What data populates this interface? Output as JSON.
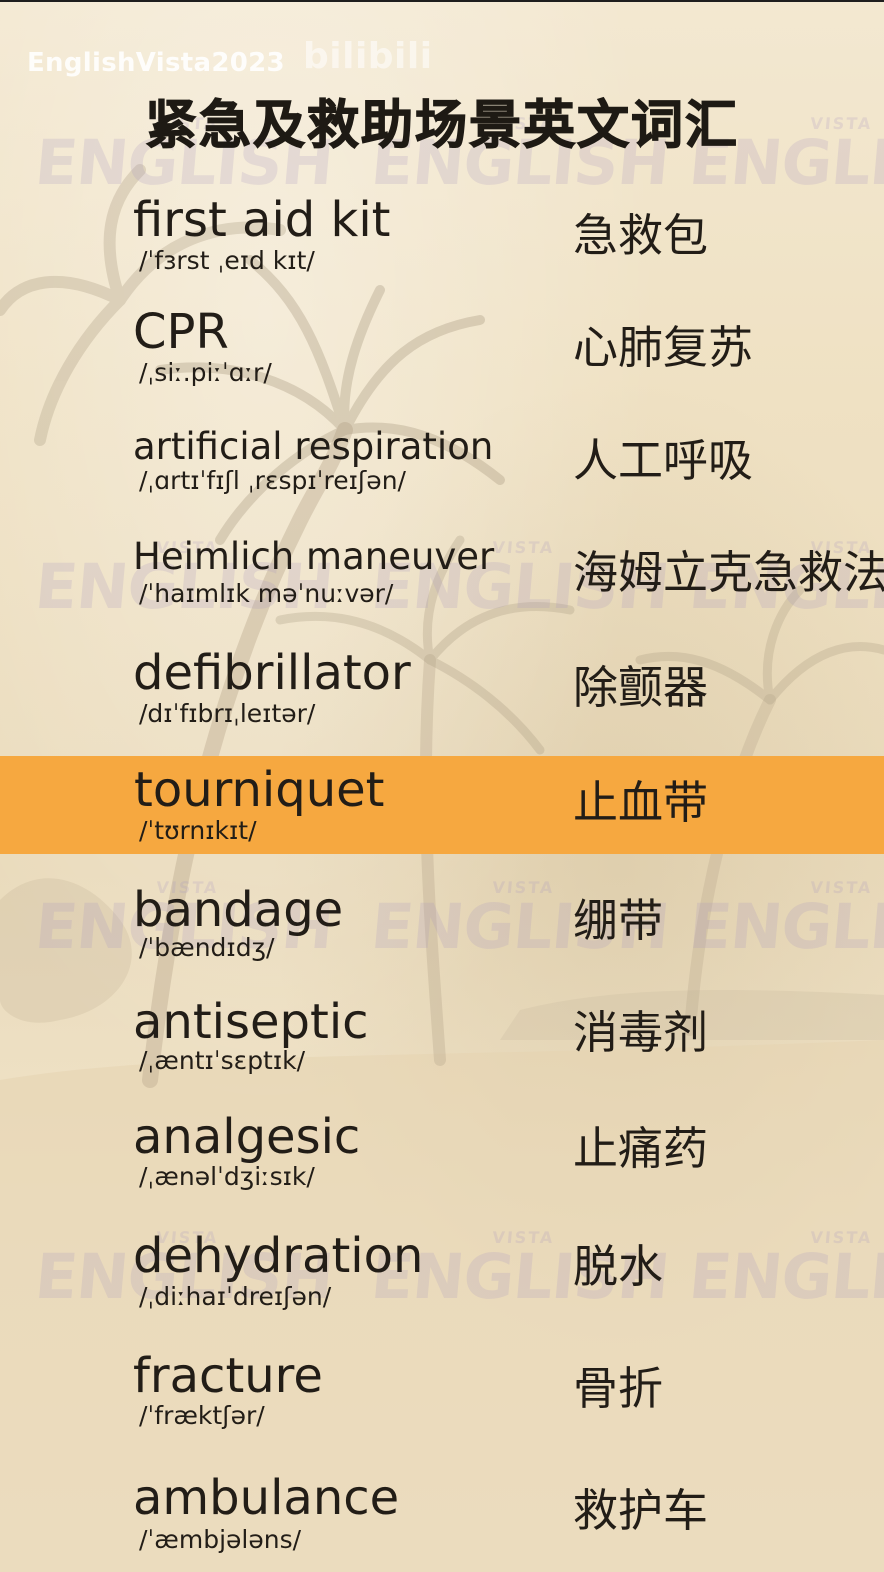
{
  "header": {
    "channel_name": "EnglishVista2023",
    "platform_logo_text": "bilibili",
    "title": "紧急及救助场景英文词汇"
  },
  "watermark": {
    "small": "VISTA",
    "big": "ENGLISH"
  },
  "vocab": [
    {
      "word": "first aid kit",
      "ipa": "/ˈfɜrst ˌeɪd kɪt/",
      "meaning": "急救包"
    },
    {
      "word": "CPR",
      "ipa": "/ˌsiː.piːˈɑːr/",
      "meaning": "心肺复苏"
    },
    {
      "word": "artificial respiration",
      "ipa": "/ˌɑrtɪˈfɪʃl ˌrɛspɪˈreɪʃən/",
      "meaning": "人工呼吸"
    },
    {
      "word": "Heimlich maneuver",
      "ipa": "/ˈhaɪmlɪk məˈnuːvər/",
      "meaning": "海姆立克急救法"
    },
    {
      "word": "defibrillator",
      "ipa": "/dɪˈfɪbrɪˌleɪtər/",
      "meaning": "除颤器"
    },
    {
      "word": "tourniquet",
      "ipa": "/ˈtʊrnɪkɪt/",
      "meaning": "止血带",
      "highlighted": true
    },
    {
      "word": "bandage",
      "ipa": "/ˈbændɪdʒ/",
      "meaning": "绷带"
    },
    {
      "word": "antiseptic",
      "ipa": "/ˌæntɪˈsɛptɪk/",
      "meaning": "消毒剂"
    },
    {
      "word": "analgesic",
      "ipa": "/ˌænəlˈdʒiːsɪk/",
      "meaning": "止痛药"
    },
    {
      "word": "dehydration",
      "ipa": "/ˌdiːhaɪˈdreɪʃən/",
      "meaning": "脱水"
    },
    {
      "word": "fracture",
      "ipa": "/ˈfræktʃər/",
      "meaning": "骨折"
    },
    {
      "word": "ambulance",
      "ipa": "/ˈæmbjələns/",
      "meaning": "救护车"
    }
  ],
  "colors": {
    "highlight": "#f6a840",
    "text": "#221d17",
    "background": "#efe2c6"
  }
}
